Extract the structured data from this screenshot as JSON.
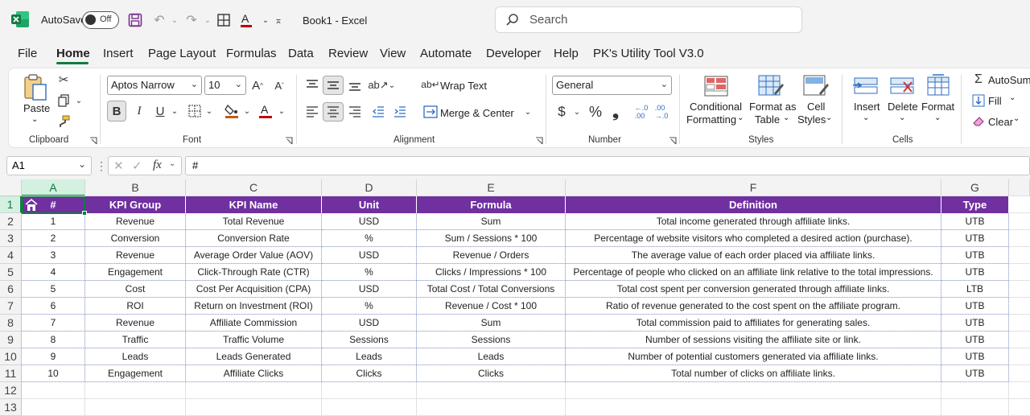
{
  "titlebar": {
    "autosave_label": "AutoSave",
    "autosave_state": "Off",
    "document_title": "Book1  -  Excel",
    "search_placeholder": "Search"
  },
  "menu": {
    "tabs": [
      "File",
      "Home",
      "Insert",
      "Page Layout",
      "Formulas",
      "Data",
      "Review",
      "View",
      "Automate",
      "Developer",
      "Help",
      "PK's Utility Tool V3.0"
    ],
    "active": "Home"
  },
  "ribbon": {
    "clipboard": {
      "paste": "Paste",
      "label": "Clipboard"
    },
    "font": {
      "family": "Aptos Narrow",
      "size": "10",
      "bold": "B",
      "italic": "I",
      "underline": "U",
      "label": "Font",
      "font_color": "#c00000",
      "fill_color": "#c55a11"
    },
    "alignment": {
      "wrap_text": "Wrap Text",
      "merge_center": "Merge & Center",
      "label": "Alignment"
    },
    "number": {
      "format": "General",
      "dollar": "$",
      "percent": "%",
      "comma": "❟",
      "label": "Number"
    },
    "styles": {
      "conditional": "Conditional",
      "conditional2": "Formatting",
      "format_as": "Format as",
      "format_as2": "Table",
      "cell": "Cell",
      "cell2": "Styles",
      "label": "Styles"
    },
    "cells": {
      "insert": "Insert",
      "delete": "Delete",
      "format": "Format",
      "label": "Cells"
    },
    "editing": {
      "autosum": "AutoSum",
      "fill": "Fill",
      "clear": "Clear"
    }
  },
  "formula_bar": {
    "name_box": "A1",
    "fx": "fx",
    "content": "#"
  },
  "sheet": {
    "columns": [
      "A",
      "B",
      "C",
      "D",
      "E",
      "F",
      "G"
    ],
    "rows": [
      "1",
      "2",
      "3",
      "4",
      "5",
      "6",
      "7",
      "8",
      "9",
      "10",
      "11",
      "12",
      "13"
    ],
    "header": [
      "#",
      "KPI Group",
      "KPI Name",
      "Unit",
      "Formula",
      "Definition",
      "Type"
    ],
    "header_color": "#7030a0",
    "data": [
      [
        "1",
        "Revenue",
        "Total Revenue",
        "USD",
        "Sum",
        "Total income generated through affiliate links.",
        "UTB"
      ],
      [
        "2",
        "Conversion",
        "Conversion Rate",
        "%",
        "Sum / Sessions * 100",
        "Percentage of website visitors who completed a desired action (purchase).",
        "UTB"
      ],
      [
        "3",
        "Revenue",
        "Average Order Value (AOV)",
        "USD",
        "Revenue / Orders",
        "The average value of each order placed via affiliate links.",
        "UTB"
      ],
      [
        "4",
        "Engagement",
        "Click-Through Rate (CTR)",
        "%",
        "Clicks / Impressions * 100",
        "Percentage of people who clicked on an affiliate link relative to the total impressions.",
        "UTB"
      ],
      [
        "5",
        "Cost",
        "Cost Per Acquisition (CPA)",
        "USD",
        "Total Cost / Total Conversions",
        "Total cost spent per conversion generated through affiliate links.",
        "LTB"
      ],
      [
        "6",
        "ROI",
        "Return on Investment (ROI)",
        "%",
        "Revenue / Cost * 100",
        "Ratio of revenue generated to the cost spent on the affiliate program.",
        "UTB"
      ],
      [
        "7",
        "Revenue",
        "Affiliate Commission",
        "USD",
        "Sum",
        "Total commission paid to affiliates for generating sales.",
        "UTB"
      ],
      [
        "8",
        "Traffic",
        "Traffic Volume",
        "Sessions",
        "Sessions",
        "Number of sessions visiting the affiliate site or link.",
        "UTB"
      ],
      [
        "9",
        "Leads",
        "Leads Generated",
        "Leads",
        "Leads",
        "Number of potential customers generated via affiliate links.",
        "UTB"
      ],
      [
        "10",
        "Engagement",
        "Affiliate Clicks",
        "Clicks",
        "Clicks",
        "Total number of clicks on affiliate links.",
        "UTB"
      ]
    ]
  }
}
